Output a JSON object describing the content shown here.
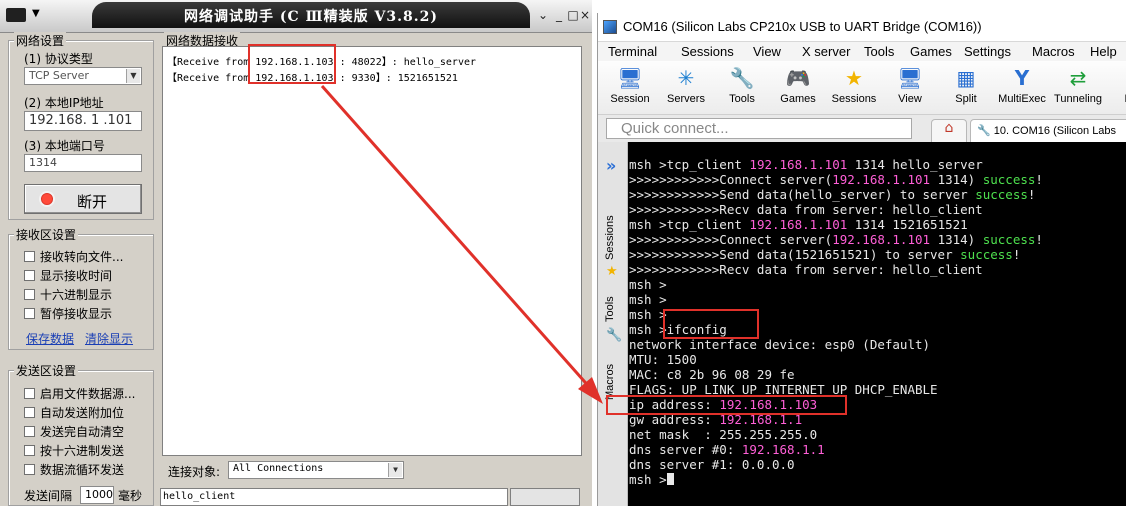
{
  "left_app": {
    "title": "网络调试助手 (C Ⅲ精装版 V3.8.2)",
    "window_buttons": [
      "⌄",
      "_",
      "□",
      "×"
    ],
    "network_settings": {
      "group_title": "网络设置",
      "protocol_label": "(1) 协议类型",
      "protocol_value": "TCP Server",
      "local_ip_label": "(2) 本地IP地址",
      "local_ip_value": "192.168. 1 .101",
      "local_port_label": "(3) 本地端口号",
      "local_port_value": "1314",
      "disconnect_label": "断开"
    },
    "receive_settings": {
      "group_title": "接收区设置",
      "options": [
        "接收转向文件...",
        "显示接收时间",
        "十六进制显示",
        "暂停接收显示"
      ],
      "save_link": "保存数据",
      "clear_link": "清除显示"
    },
    "send_settings": {
      "group_title": "发送区设置",
      "options": [
        "启用文件数据源...",
        "自动发送附加位",
        "发送完自动清空",
        "按十六进制发送",
        "数据流循环发送"
      ],
      "interval_label": "发送间隔",
      "interval_value": "1000",
      "interval_unit": "毫秒"
    },
    "receive_area": {
      "title": "网络数据接收",
      "lines": [
        {
          "prefix": "【Receive from ",
          "ip": "192.168.1.103",
          "rest": " : 48022】: hello_server"
        },
        {
          "prefix": "【Receive from ",
          "ip": "192.168.1.103",
          "rest": " : 9330】: 1521651521"
        }
      ]
    },
    "connection": {
      "label": "连接对象:",
      "value": "All Connections"
    },
    "send_area_text": "hello_client"
  },
  "right_app": {
    "title": "COM16  (Silicon Labs CP210x USB to UART Bridge (COM16))",
    "menu": [
      "Terminal",
      "Sessions",
      "View",
      "X server",
      "Tools",
      "Games",
      "Settings",
      "Macros",
      "Help"
    ],
    "toolbar": [
      {
        "label": "Session",
        "icon": "monitor-icon",
        "glyph": "🖥"
      },
      {
        "label": "Servers",
        "icon": "servers-icon",
        "glyph": "✳"
      },
      {
        "label": "Tools",
        "icon": "tools-icon",
        "glyph": "🔧"
      },
      {
        "label": "Games",
        "icon": "gamepad-icon",
        "glyph": "🎮"
      },
      {
        "label": "Sessions",
        "icon": "star-icon",
        "glyph": "★"
      },
      {
        "label": "View",
        "icon": "view-icon",
        "glyph": "🖥"
      },
      {
        "label": "Split",
        "icon": "split-icon",
        "glyph": "▦"
      },
      {
        "label": "MultiExec",
        "icon": "multiexec-icon",
        "glyph": "Y"
      },
      {
        "label": "Tunneling",
        "icon": "tunneling-icon",
        "glyph": "⇄"
      },
      {
        "label": "Pac",
        "icon": "packages-icon",
        "glyph": "▣"
      }
    ],
    "quick_connect_placeholder": "Quick connect...",
    "session_tab": "10. COM16 (Silicon Labs",
    "sidebar_tabs": [
      "Sessions",
      "Tools",
      "Macros"
    ],
    "colors": {
      "ip": "#ff5fd7",
      "success": "#4ee04e",
      "terminal_bg": "#000000",
      "annotation": "#e0312a"
    },
    "terminal_lines": [
      [
        {
          "t": "msh >tcp_client "
        },
        {
          "t": "192.168.1.101",
          "c": "ip"
        },
        {
          "t": " 1314 hello_server"
        }
      ],
      [
        {
          "t": ">>>>>>>>>>>>Connect server("
        },
        {
          "t": "192.168.1.101",
          "c": "ip"
        },
        {
          "t": " 1314) "
        },
        {
          "t": "success",
          "c": "ok"
        },
        {
          "t": "!"
        }
      ],
      [
        {
          "t": ">>>>>>>>>>>>Send data(hello_server) to server "
        },
        {
          "t": "success",
          "c": "ok"
        },
        {
          "t": "!"
        }
      ],
      [
        {
          "t": ">>>>>>>>>>>>Recv data from server: hello_client"
        }
      ],
      [
        {
          "t": "msh >tcp_client "
        },
        {
          "t": "192.168.1.101",
          "c": "ip"
        },
        {
          "t": " 1314 1521651521"
        }
      ],
      [
        {
          "t": ">>>>>>>>>>>>Connect server("
        },
        {
          "t": "192.168.1.101",
          "c": "ip"
        },
        {
          "t": " 1314) "
        },
        {
          "t": "success",
          "c": "ok"
        },
        {
          "t": "!"
        }
      ],
      [
        {
          "t": ">>>>>>>>>>>>Send data(1521651521) to server "
        },
        {
          "t": "success",
          "c": "ok"
        },
        {
          "t": "!"
        }
      ],
      [
        {
          "t": ">>>>>>>>>>>>Recv data from server: hello_client"
        }
      ],
      [
        {
          "t": "msh >"
        }
      ],
      [
        {
          "t": "msh >"
        }
      ],
      [
        {
          "t": "msh >"
        }
      ],
      [
        {
          "t": "msh >ifconfig"
        }
      ],
      [
        {
          "t": "network interface device: esp0 (Default)"
        }
      ],
      [
        {
          "t": "MTU: 1500"
        }
      ],
      [
        {
          "t": "MAC: c8 2b 96 08 29 fe"
        }
      ],
      [
        {
          "t": "FLAGS: UP LINK_UP INTERNET_UP DHCP_ENABLE"
        }
      ],
      [
        {
          "t": "ip address: "
        },
        {
          "t": "192.168.1.103",
          "c": "ip"
        }
      ],
      [
        {
          "t": "gw address: "
        },
        {
          "t": "192.168.1.1",
          "c": "ip"
        }
      ],
      [
        {
          "t": "net mask  : 255.255.255.0"
        }
      ],
      [
        {
          "t": "dns server #0: "
        },
        {
          "t": "192.168.1.1",
          "c": "ip"
        }
      ],
      [
        {
          "t": "dns server #1: 0.0.0.0"
        }
      ],
      [
        {
          "t": "msh >"
        }
      ]
    ]
  }
}
